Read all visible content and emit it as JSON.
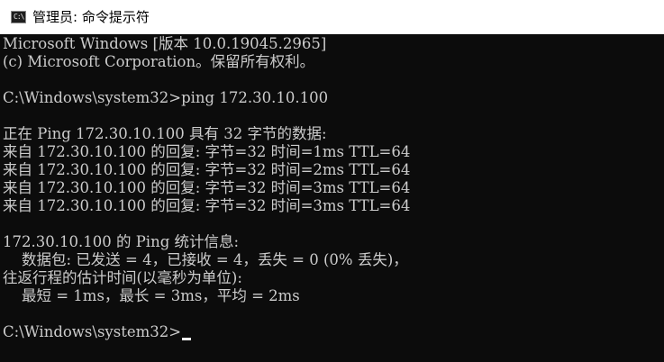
{
  "window": {
    "title": "管理员: 命令提示符",
    "icon": "cmd-icon",
    "icon_glyph": "C:\\"
  },
  "console": {
    "lines": [
      "Microsoft Windows [版本 10.0.19045.2965]",
      "(c) Microsoft Corporation。保留所有权利。",
      "",
      "C:\\Windows\\system32>ping 172.30.10.100",
      "",
      "正在 Ping 172.30.10.100 具有 32 字节的数据:",
      "来自 172.30.10.100 的回复: 字节=32 时间=1ms TTL=64",
      "来自 172.30.10.100 的回复: 字节=32 时间=2ms TTL=64",
      "来自 172.30.10.100 的回复: 字节=32 时间=3ms TTL=64",
      "来自 172.30.10.100 的回复: 字节=32 时间=3ms TTL=64",
      "",
      "172.30.10.100 的 Ping 统计信息:",
      "    数据包: 已发送 = 4，已接收 = 4，丢失 = 0 (0% 丢失)，",
      "往返行程的估计时间(以毫秒为单位):",
      "    最短 = 1ms，最长 = 3ms，平均 = 2ms",
      ""
    ],
    "prompt": "C:\\Windows\\system32>"
  },
  "colors": {
    "background": "#0c0c0c",
    "text": "#cccccc",
    "titlebar": "#ffffff"
  }
}
